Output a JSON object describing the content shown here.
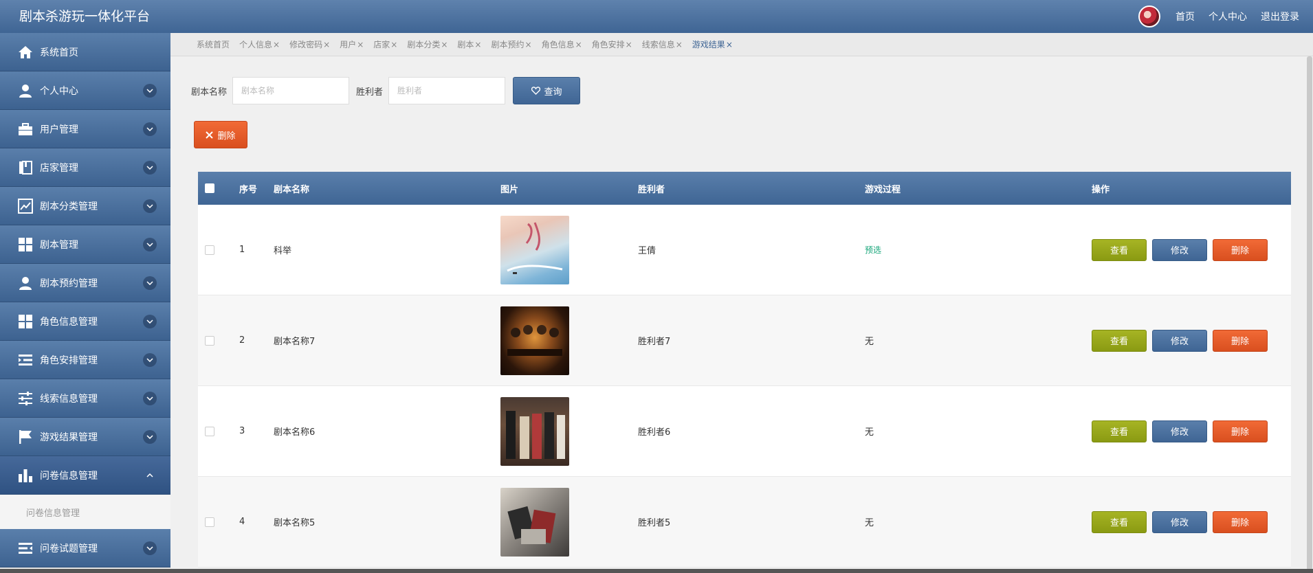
{
  "header": {
    "title": "剧本杀游玩一体化平台",
    "links": [
      "首页",
      "个人中心",
      "退出登录"
    ]
  },
  "sidebar": {
    "items": [
      {
        "label": "系统首页",
        "icon": "home-icon",
        "chevron": false
      },
      {
        "label": "个人中心",
        "icon": "person-icon",
        "chevron": true
      },
      {
        "label": "用户管理",
        "icon": "briefcase-icon",
        "chevron": true
      },
      {
        "label": "店家管理",
        "icon": "book-icon",
        "chevron": true
      },
      {
        "label": "剧本分类管理",
        "icon": "chart-line-icon",
        "chevron": true
      },
      {
        "label": "剧本管理",
        "icon": "grid-icon",
        "chevron": true
      },
      {
        "label": "剧本预约管理",
        "icon": "person-icon",
        "chevron": true
      },
      {
        "label": "角色信息管理",
        "icon": "grid-icon",
        "chevron": true
      },
      {
        "label": "角色安排管理",
        "icon": "list-indent-icon",
        "chevron": true
      },
      {
        "label": "线索信息管理",
        "icon": "sliders-icon",
        "chevron": true
      },
      {
        "label": "游戏结果管理",
        "icon": "flag-icon",
        "chevron": true
      },
      {
        "label": "问卷信息管理",
        "icon": "bar-chart-icon",
        "chevron": true,
        "expanded": true
      }
    ],
    "sub_item": "问卷信息管理",
    "last_item": {
      "label": "问卷试题管理",
      "icon": "list-indent-icon"
    }
  },
  "tabs": [
    {
      "label": "系统首页",
      "closable": false
    },
    {
      "label": "个人信息",
      "closable": true
    },
    {
      "label": "修改密码",
      "closable": true
    },
    {
      "label": "用户",
      "closable": true
    },
    {
      "label": "店家",
      "closable": true
    },
    {
      "label": "剧本分类",
      "closable": true
    },
    {
      "label": "剧本",
      "closable": true
    },
    {
      "label": "剧本预约",
      "closable": true
    },
    {
      "label": "角色信息",
      "closable": true
    },
    {
      "label": "角色安排",
      "closable": true
    },
    {
      "label": "线索信息",
      "closable": true
    },
    {
      "label": "游戏结果",
      "closable": true,
      "current": true
    }
  ],
  "tab_close": "×",
  "search": {
    "name_label": "剧本名称",
    "name_placeholder": "剧本名称",
    "winner_label": "胜利者",
    "winner_placeholder": "胜利者",
    "query_label": "查询"
  },
  "delete_label": "删除",
  "table": {
    "headers": [
      "序号",
      "剧本名称",
      "图片",
      "胜利者",
      "游戏过程",
      "操作"
    ],
    "rows": [
      {
        "no": "1",
        "name": "科举",
        "winner": "王倩",
        "process": "预选",
        "process_highlight": true
      },
      {
        "no": "2",
        "name": "剧本名称7",
        "winner": "胜利者7",
        "process": "无"
      },
      {
        "no": "3",
        "name": "剧本名称6",
        "winner": "胜利者6",
        "process": "无"
      },
      {
        "no": "4",
        "name": "剧本名称5",
        "winner": "胜利者5",
        "process": "无"
      }
    ],
    "actions": {
      "view": "查看",
      "edit": "修改",
      "delete": "删除"
    }
  },
  "colors": {
    "primary": "#3f6594",
    "danger": "#d94f1f",
    "olive": "#8a9a12",
    "success_text": "#18a67a"
  }
}
